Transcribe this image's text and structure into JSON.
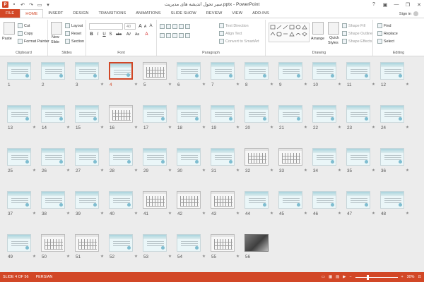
{
  "window": {
    "title": "سیر تحول اندیشه های مدیریت.pptx - PowerPoint",
    "qat_icons": [
      "save-icon",
      "undo-icon",
      "redo-icon",
      "start-from-beginning-icon",
      "customize-qat-icon"
    ],
    "controls": {
      "help": "?",
      "ribbon_options": "▣",
      "minimize": "—",
      "restore": "❐",
      "close": "✕"
    }
  },
  "tabs": {
    "file": "FILE",
    "items": [
      "HOME",
      "INSERT",
      "DESIGN",
      "TRANSITIONS",
      "ANIMATIONS",
      "SLIDE SHOW",
      "REVIEW",
      "VIEW",
      "ADD-INS"
    ],
    "active": "HOME",
    "signin": "Sign in"
  },
  "ribbon": {
    "clipboard": {
      "label": "Clipboard",
      "paste": "Paste",
      "cut": "Cut",
      "copy": "Copy",
      "format_painter": "Format Painter"
    },
    "slides": {
      "label": "Slides",
      "new_slide": "New",
      "new_slide_2": "Slide",
      "layout": "Layout",
      "reset": "Reset",
      "section": "Section"
    },
    "font": {
      "label": "Font",
      "font_name": "",
      "font_size": "40",
      "bold": "B",
      "italic": "I",
      "underline": "U",
      "shadow": "S",
      "strike": "abc",
      "spacing": "AV",
      "case": "Aa",
      "color": "A",
      "grow": "A",
      "shrink": "A",
      "clear": "A"
    },
    "paragraph": {
      "label": "Paragraph",
      "text_direction": "Text Direction",
      "align_text": "Align Text",
      "convert_smartart": "Convert to SmartArt"
    },
    "drawing": {
      "label": "Drawing",
      "arrange": "Arrange",
      "quick_styles": "Quick",
      "quick_styles_2": "Styles",
      "shape_fill": "Shape Fill",
      "shape_outline": "Shape Outline",
      "shape_effects": "Shape Effects"
    },
    "editing": {
      "label": "Editing",
      "find": "Find",
      "replace": "Replace",
      "select": "Select"
    }
  },
  "slides": {
    "selected": 4,
    "star": "★",
    "items": [
      {
        "n": "1",
        "kind": "title"
      },
      {
        "n": "2",
        "kind": "text"
      },
      {
        "n": "3",
        "kind": "text"
      },
      {
        "n": "4",
        "kind": "text"
      },
      {
        "n": "5",
        "kind": "diagram"
      },
      {
        "n": "6",
        "kind": "text"
      },
      {
        "n": "7",
        "kind": "text"
      },
      {
        "n": "8",
        "kind": "text"
      },
      {
        "n": "9",
        "kind": "text"
      },
      {
        "n": "10",
        "kind": "text"
      },
      {
        "n": "11",
        "kind": "text"
      },
      {
        "n": "12",
        "kind": "text"
      },
      {
        "n": "13",
        "kind": "text"
      },
      {
        "n": "14",
        "kind": "text"
      },
      {
        "n": "15",
        "kind": "text"
      },
      {
        "n": "16",
        "kind": "diagram"
      },
      {
        "n": "17",
        "kind": "text"
      },
      {
        "n": "18",
        "kind": "text"
      },
      {
        "n": "19",
        "kind": "text"
      },
      {
        "n": "20",
        "kind": "text"
      },
      {
        "n": "21",
        "kind": "text"
      },
      {
        "n": "22",
        "kind": "text"
      },
      {
        "n": "23",
        "kind": "text"
      },
      {
        "n": "24",
        "kind": "text"
      },
      {
        "n": "25",
        "kind": "text"
      },
      {
        "n": "26",
        "kind": "text"
      },
      {
        "n": "27",
        "kind": "text"
      },
      {
        "n": "28",
        "kind": "text"
      },
      {
        "n": "29",
        "kind": "text"
      },
      {
        "n": "30",
        "kind": "text"
      },
      {
        "n": "31",
        "kind": "text"
      },
      {
        "n": "32",
        "kind": "diagram"
      },
      {
        "n": "33",
        "kind": "diagram"
      },
      {
        "n": "34",
        "kind": "text"
      },
      {
        "n": "35",
        "kind": "text"
      },
      {
        "n": "36",
        "kind": "text"
      },
      {
        "n": "37",
        "kind": "text"
      },
      {
        "n": "38",
        "kind": "text"
      },
      {
        "n": "39",
        "kind": "text"
      },
      {
        "n": "40",
        "kind": "text"
      },
      {
        "n": "41",
        "kind": "diagram"
      },
      {
        "n": "42",
        "kind": "diagram"
      },
      {
        "n": "43",
        "kind": "diagram"
      },
      {
        "n": "44",
        "kind": "text"
      },
      {
        "n": "45",
        "kind": "text"
      },
      {
        "n": "46",
        "kind": "text"
      },
      {
        "n": "47",
        "kind": "text"
      },
      {
        "n": "48",
        "kind": "text"
      },
      {
        "n": "49",
        "kind": "text"
      },
      {
        "n": "50",
        "kind": "diagram"
      },
      {
        "n": "51",
        "kind": "diagram"
      },
      {
        "n": "52",
        "kind": "text"
      },
      {
        "n": "53",
        "kind": "text"
      },
      {
        "n": "54",
        "kind": "text"
      },
      {
        "n": "55",
        "kind": "diagram"
      },
      {
        "n": "56",
        "kind": "photo"
      }
    ]
  },
  "status": {
    "slide_info": "SLIDE 4 OF 56",
    "language": "PERSIAN",
    "zoom": "30%",
    "zoom_level": 0.3,
    "zoom_out": "−",
    "zoom_in": "+",
    "fit_icon": "fit-slide-icon"
  }
}
